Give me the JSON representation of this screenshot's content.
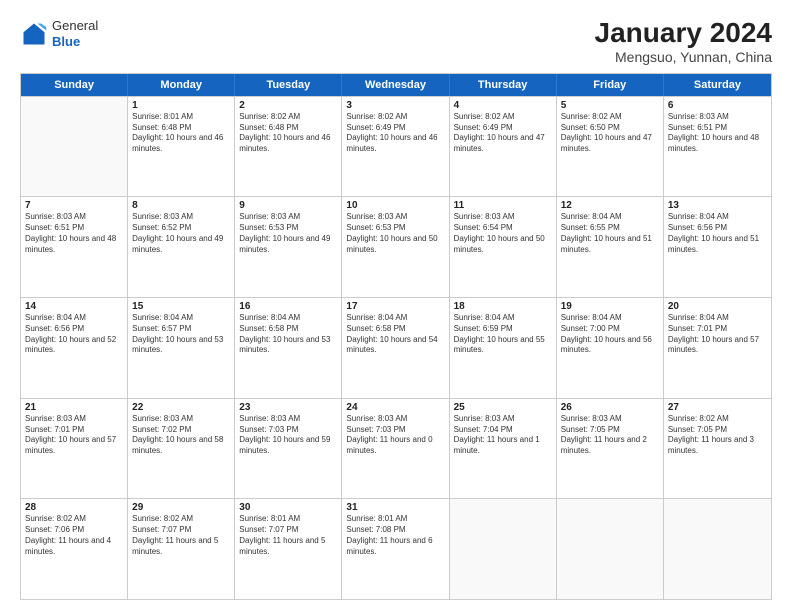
{
  "logo": {
    "general": "General",
    "blue": "Blue"
  },
  "title": "January 2024",
  "subtitle": "Mengsuo, Yunnan, China",
  "days_of_week": [
    "Sunday",
    "Monday",
    "Tuesday",
    "Wednesday",
    "Thursday",
    "Friday",
    "Saturday"
  ],
  "weeks": [
    [
      {
        "day": "",
        "empty": true
      },
      {
        "day": "1",
        "sunrise": "8:01 AM",
        "sunset": "6:48 PM",
        "daylight": "10 hours and 46 minutes."
      },
      {
        "day": "2",
        "sunrise": "8:02 AM",
        "sunset": "6:48 PM",
        "daylight": "10 hours and 46 minutes."
      },
      {
        "day": "3",
        "sunrise": "8:02 AM",
        "sunset": "6:49 PM",
        "daylight": "10 hours and 46 minutes."
      },
      {
        "day": "4",
        "sunrise": "8:02 AM",
        "sunset": "6:49 PM",
        "daylight": "10 hours and 47 minutes."
      },
      {
        "day": "5",
        "sunrise": "8:02 AM",
        "sunset": "6:50 PM",
        "daylight": "10 hours and 47 minutes."
      },
      {
        "day": "6",
        "sunrise": "8:03 AM",
        "sunset": "6:51 PM",
        "daylight": "10 hours and 48 minutes."
      }
    ],
    [
      {
        "day": "7",
        "sunrise": "8:03 AM",
        "sunset": "6:51 PM",
        "daylight": "10 hours and 48 minutes."
      },
      {
        "day": "8",
        "sunrise": "8:03 AM",
        "sunset": "6:52 PM",
        "daylight": "10 hours and 49 minutes."
      },
      {
        "day": "9",
        "sunrise": "8:03 AM",
        "sunset": "6:53 PM",
        "daylight": "10 hours and 49 minutes."
      },
      {
        "day": "10",
        "sunrise": "8:03 AM",
        "sunset": "6:53 PM",
        "daylight": "10 hours and 50 minutes."
      },
      {
        "day": "11",
        "sunrise": "8:03 AM",
        "sunset": "6:54 PM",
        "daylight": "10 hours and 50 minutes."
      },
      {
        "day": "12",
        "sunrise": "8:04 AM",
        "sunset": "6:55 PM",
        "daylight": "10 hours and 51 minutes."
      },
      {
        "day": "13",
        "sunrise": "8:04 AM",
        "sunset": "6:56 PM",
        "daylight": "10 hours and 51 minutes."
      }
    ],
    [
      {
        "day": "14",
        "sunrise": "8:04 AM",
        "sunset": "6:56 PM",
        "daylight": "10 hours and 52 minutes."
      },
      {
        "day": "15",
        "sunrise": "8:04 AM",
        "sunset": "6:57 PM",
        "daylight": "10 hours and 53 minutes."
      },
      {
        "day": "16",
        "sunrise": "8:04 AM",
        "sunset": "6:58 PM",
        "daylight": "10 hours and 53 minutes."
      },
      {
        "day": "17",
        "sunrise": "8:04 AM",
        "sunset": "6:58 PM",
        "daylight": "10 hours and 54 minutes."
      },
      {
        "day": "18",
        "sunrise": "8:04 AM",
        "sunset": "6:59 PM",
        "daylight": "10 hours and 55 minutes."
      },
      {
        "day": "19",
        "sunrise": "8:04 AM",
        "sunset": "7:00 PM",
        "daylight": "10 hours and 56 minutes."
      },
      {
        "day": "20",
        "sunrise": "8:04 AM",
        "sunset": "7:01 PM",
        "daylight": "10 hours and 57 minutes."
      }
    ],
    [
      {
        "day": "21",
        "sunrise": "8:03 AM",
        "sunset": "7:01 PM",
        "daylight": "10 hours and 57 minutes."
      },
      {
        "day": "22",
        "sunrise": "8:03 AM",
        "sunset": "7:02 PM",
        "daylight": "10 hours and 58 minutes."
      },
      {
        "day": "23",
        "sunrise": "8:03 AM",
        "sunset": "7:03 PM",
        "daylight": "10 hours and 59 minutes."
      },
      {
        "day": "24",
        "sunrise": "8:03 AM",
        "sunset": "7:03 PM",
        "daylight": "11 hours and 0 minutes."
      },
      {
        "day": "25",
        "sunrise": "8:03 AM",
        "sunset": "7:04 PM",
        "daylight": "11 hours and 1 minute."
      },
      {
        "day": "26",
        "sunrise": "8:03 AM",
        "sunset": "7:05 PM",
        "daylight": "11 hours and 2 minutes."
      },
      {
        "day": "27",
        "sunrise": "8:02 AM",
        "sunset": "7:05 PM",
        "daylight": "11 hours and 3 minutes."
      }
    ],
    [
      {
        "day": "28",
        "sunrise": "8:02 AM",
        "sunset": "7:06 PM",
        "daylight": "11 hours and 4 minutes."
      },
      {
        "day": "29",
        "sunrise": "8:02 AM",
        "sunset": "7:07 PM",
        "daylight": "11 hours and 5 minutes."
      },
      {
        "day": "30",
        "sunrise": "8:01 AM",
        "sunset": "7:07 PM",
        "daylight": "11 hours and 5 minutes."
      },
      {
        "day": "31",
        "sunrise": "8:01 AM",
        "sunset": "7:08 PM",
        "daylight": "11 hours and 6 minutes."
      },
      {
        "day": "",
        "empty": true
      },
      {
        "day": "",
        "empty": true
      },
      {
        "day": "",
        "empty": true
      }
    ]
  ]
}
